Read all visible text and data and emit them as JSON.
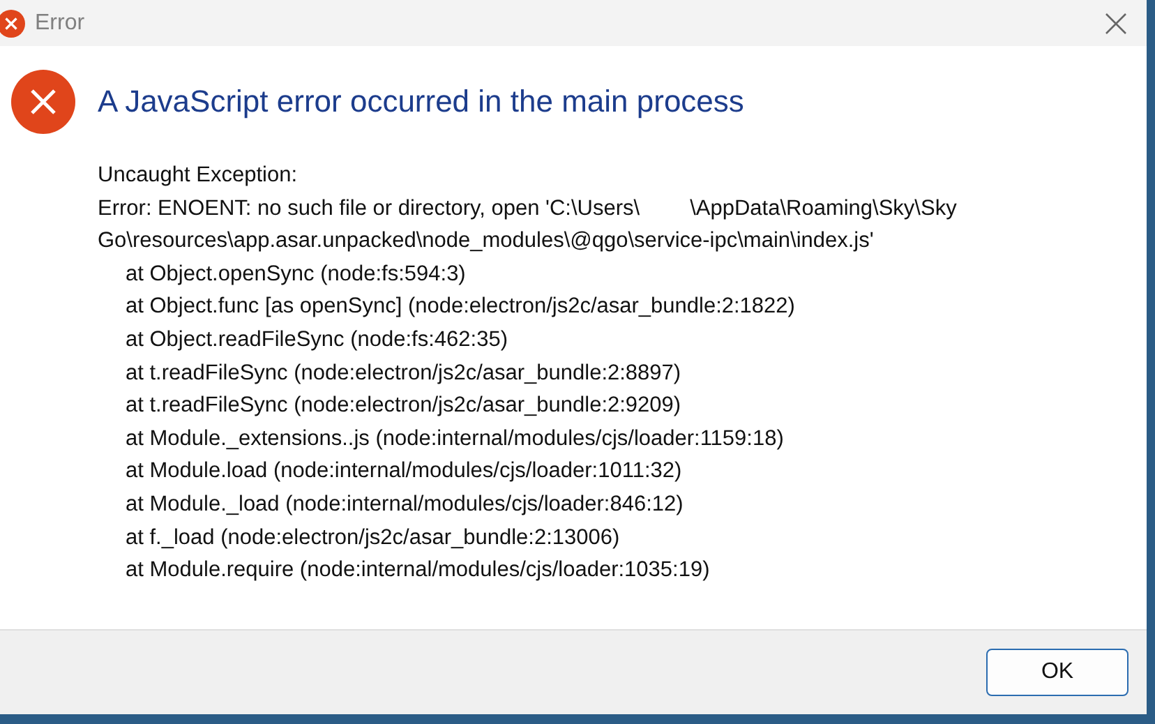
{
  "window": {
    "title": "Error"
  },
  "heading": "A JavaScript error occurred in the main process",
  "exception_label": "Uncaught Exception:",
  "message_lines": [
    [
      "Error: ENOENT: no such file or directory, open 'C:\\Users\\",
      "\\AppData\\Roaming\\Sky\\Sky"
    ],
    [
      "Go\\resources\\app.asar.unpacked\\node_modules\\@qgo\\service-ipc\\main\\index.js'"
    ]
  ],
  "stack": [
    "at Object.openSync (node:fs:594:3)",
    "at Object.func [as openSync] (node:electron/js2c/asar_bundle:2:1822)",
    "at Object.readFileSync (node:fs:462:35)",
    "at t.readFileSync (node:electron/js2c/asar_bundle:2:8897)",
    "at t.readFileSync (node:electron/js2c/asar_bundle:2:9209)",
    "at Module._extensions..js (node:internal/modules/cjs/loader:1159:18)",
    "at Module.load (node:internal/modules/cjs/loader:1011:32)",
    "at Module._load (node:internal/modules/cjs/loader:846:12)",
    "at f._load (node:electron/js2c/asar_bundle:2:13006)",
    "at Module.require (node:internal/modules/cjs/loader:1035:19)"
  ],
  "buttons": [
    "OK"
  ]
}
